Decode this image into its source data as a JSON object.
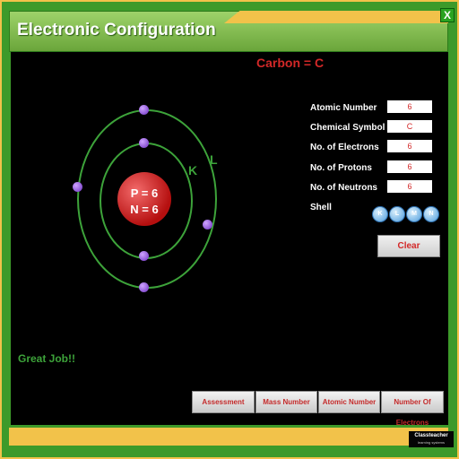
{
  "window": {
    "title": "Electronic Configuration",
    "close_label": "X"
  },
  "element": {
    "title": "Carbon = C"
  },
  "atom": {
    "nucleus": {
      "protons_text": "P = 6",
      "neutrons_text": "N = 6"
    },
    "shells": [
      {
        "label": "K",
        "electrons": 2
      },
      {
        "label": "L",
        "electrons": 4
      }
    ]
  },
  "info": {
    "rows": [
      {
        "label": "Atomic Number",
        "value": "6"
      },
      {
        "label": "Chemical Symbol",
        "value": "C"
      },
      {
        "label": "No. of Electrons",
        "value": "6"
      },
      {
        "label": "No. of Protons",
        "value": "6"
      },
      {
        "label": "No. of Neutrons",
        "value": "6"
      }
    ],
    "shell_label": "Shell",
    "shell_buttons": [
      "K",
      "L",
      "M",
      "N"
    ],
    "clear_label": "Clear"
  },
  "feedback": "Great Job!!",
  "bottom_buttons": [
    "Assessment",
    "Mass Number",
    "Atomic Number",
    "Number Of Electrons"
  ],
  "logo": {
    "name": "Classteacher",
    "tagline": "learning systems"
  },
  "colors": {
    "green": "#3d9a2a",
    "yellow": "#f2c24a",
    "red": "#d32828"
  }
}
